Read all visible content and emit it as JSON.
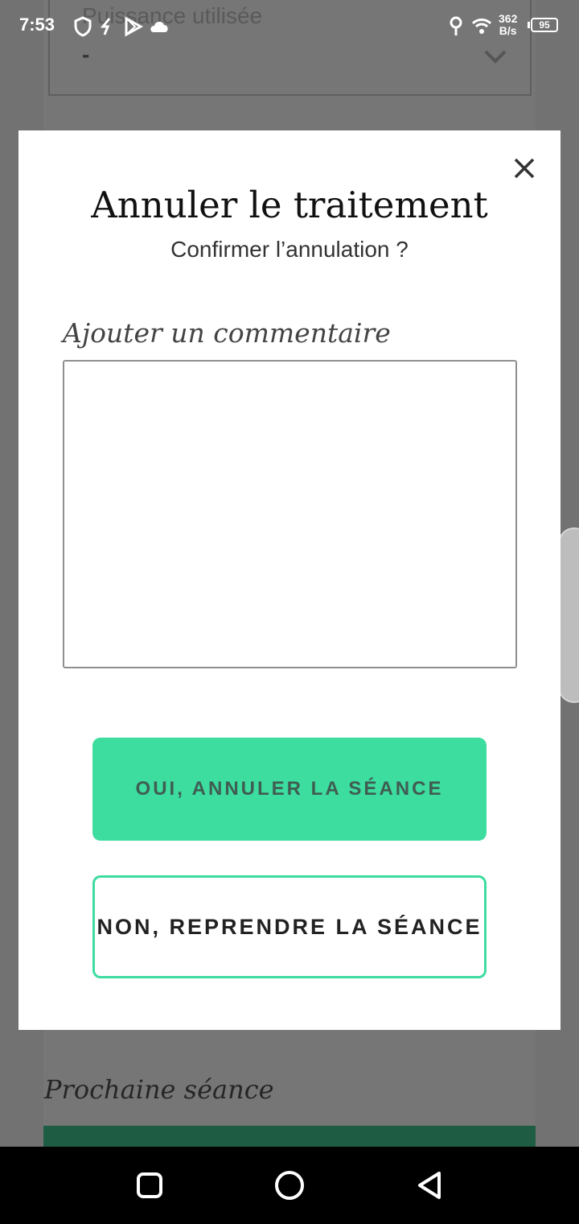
{
  "status_bar": {
    "time": "7:53",
    "net_speed_value": "362",
    "net_speed_unit": "B/s",
    "battery": "95",
    "icons": [
      "shield-icon",
      "link-icon",
      "play-store-icon",
      "cloud-icon",
      "key-icon",
      "wifi-icon"
    ]
  },
  "background": {
    "select_label": "Puissance utilisée",
    "select_value": "-",
    "next_session_title": "Prochaine séance",
    "accent_dark": "#1e5c44"
  },
  "modal": {
    "title": "Annuler le traitement",
    "subtitle": "Confirmer l’annulation ?",
    "comment_label": "Ajouter un commentaire",
    "comment_value": "",
    "confirm_button": "OUI, ANNULER LA SÉANCE",
    "cancel_button": "NON, REPRENDRE LA SÉANCE",
    "accent_color": "#3ddc9f"
  },
  "nav_bar": {
    "buttons": [
      "recents-icon",
      "home-icon",
      "back-icon"
    ]
  }
}
